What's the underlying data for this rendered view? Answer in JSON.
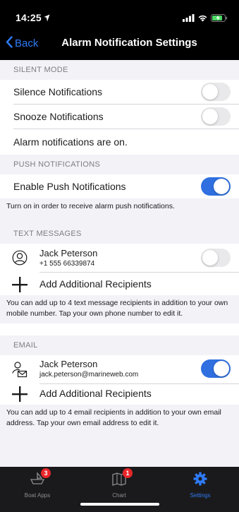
{
  "status_bar": {
    "time": "14:25"
  },
  "nav": {
    "back_label": "Back",
    "title": "Alarm Notification Settings"
  },
  "silent_mode": {
    "header": "SILENT MODE",
    "silence_label": "Silence Notifications",
    "silence_on": false,
    "snooze_label": "Snooze Notifications",
    "snooze_on": false,
    "status_text": "Alarm notifications are on."
  },
  "push": {
    "header": "PUSH NOTIFICATIONS",
    "enable_label": "Enable Push Notifications",
    "enable_on": true,
    "note": "Turn on in order to receive alarm push notifications."
  },
  "text_messages": {
    "header": "TEXT MESSAGES",
    "contact": {
      "name": "Jack Peterson",
      "phone": "+1 555 66339874",
      "enabled": false
    },
    "add_label": "Add Additional Recipients",
    "note": "You can add up to 4 text message recipients in addition to your own mobile number. Tap your own phone number to edit it."
  },
  "email": {
    "header": "EMAIL",
    "contact": {
      "name": "Jack Peterson",
      "email": "jack.peterson@marineweb.com",
      "enabled": true
    },
    "add_label": "Add Additional Recipients",
    "note": "You can add up to 4 email recipients in addition to your own email address. Tap your own email address to edit it."
  },
  "tabs": [
    {
      "label": "Boat Apps",
      "badge": "3",
      "icon": "boat-icon"
    },
    {
      "label": "Chart",
      "badge": "1",
      "icon": "chart-icon"
    },
    {
      "label": "Settings",
      "badge": "",
      "icon": "gear-icon"
    }
  ],
  "colors": {
    "accent": "#2f7af6",
    "toggle_on": "#2f6fe0",
    "badge": "#e8262b"
  }
}
